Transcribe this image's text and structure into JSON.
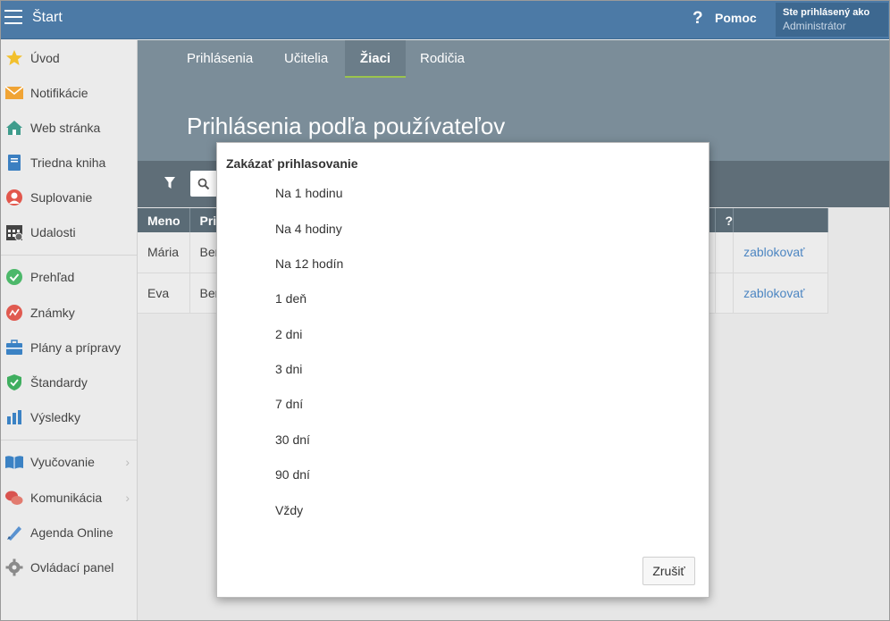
{
  "topbar": {
    "title": "Štart",
    "help_label": "Pomoc",
    "help_icon_glyph": "?",
    "user_label": "Ste prihlásený ako",
    "user_name": "Administrátor"
  },
  "sidebar": {
    "items": [
      {
        "label": "Úvod",
        "icon": "star-icon"
      },
      {
        "label": "Notifikácie",
        "icon": "envelope-icon"
      },
      {
        "label": "Web stránka",
        "icon": "house-icon"
      },
      {
        "label": "Triedna kniha",
        "icon": "book-icon"
      },
      {
        "label": "Suplovanie",
        "icon": "person-icon"
      },
      {
        "label": "Udalosti",
        "icon": "calendar-icon"
      },
      {
        "label": "Prehľad",
        "icon": "check-circle-icon"
      },
      {
        "label": "Známky",
        "icon": "grades-icon"
      },
      {
        "label": "Plány a prípravy",
        "icon": "briefcase-icon"
      },
      {
        "label": "Štandardy",
        "icon": "shield-check-icon"
      },
      {
        "label": "Výsledky",
        "icon": "bar-chart-icon"
      },
      {
        "label": "Vyučovanie",
        "icon": "open-book-icon",
        "submenu": true
      },
      {
        "label": "Komunikácia",
        "icon": "chat-bubbles-icon",
        "submenu": true
      },
      {
        "label": "Agenda Online",
        "icon": "pen-icon"
      },
      {
        "label": "Ovládací panel",
        "icon": "gear-icon"
      }
    ],
    "chevron_glyph": "›"
  },
  "tabs": [
    {
      "label": "Prihlásenia"
    },
    {
      "label": "Učitelia"
    },
    {
      "label": "Žiaci",
      "active": true
    },
    {
      "label": "Rodičia"
    }
  ],
  "page": {
    "title": "Prihlásenia podľa používateľov"
  },
  "table": {
    "headers": {
      "meno": "Meno",
      "pri": "Pri",
      "q": "?"
    },
    "rows": [
      {
        "meno": "Mária",
        "pri": "Ber",
        "action": "zablokovať"
      },
      {
        "meno": "Eva",
        "pri": "Ber",
        "action": "zablokovať"
      }
    ]
  },
  "modal": {
    "title": "Zakázať prihlasovanie",
    "options": [
      "Na 1 hodinu",
      "Na 4 hodiny",
      "Na 12 hodín",
      "1 deň",
      "2 dni",
      "3 dni",
      "7 dní",
      "30 dní",
      "90 dní",
      "Vždy"
    ],
    "cancel_label": "Zrušiť"
  },
  "colors": {
    "topbar": "#4c7aa6",
    "header": "#7b8d99",
    "filterbar": "#5f6e78",
    "active_tab_underline": "#9bc44d",
    "link": "#4d86c2"
  }
}
